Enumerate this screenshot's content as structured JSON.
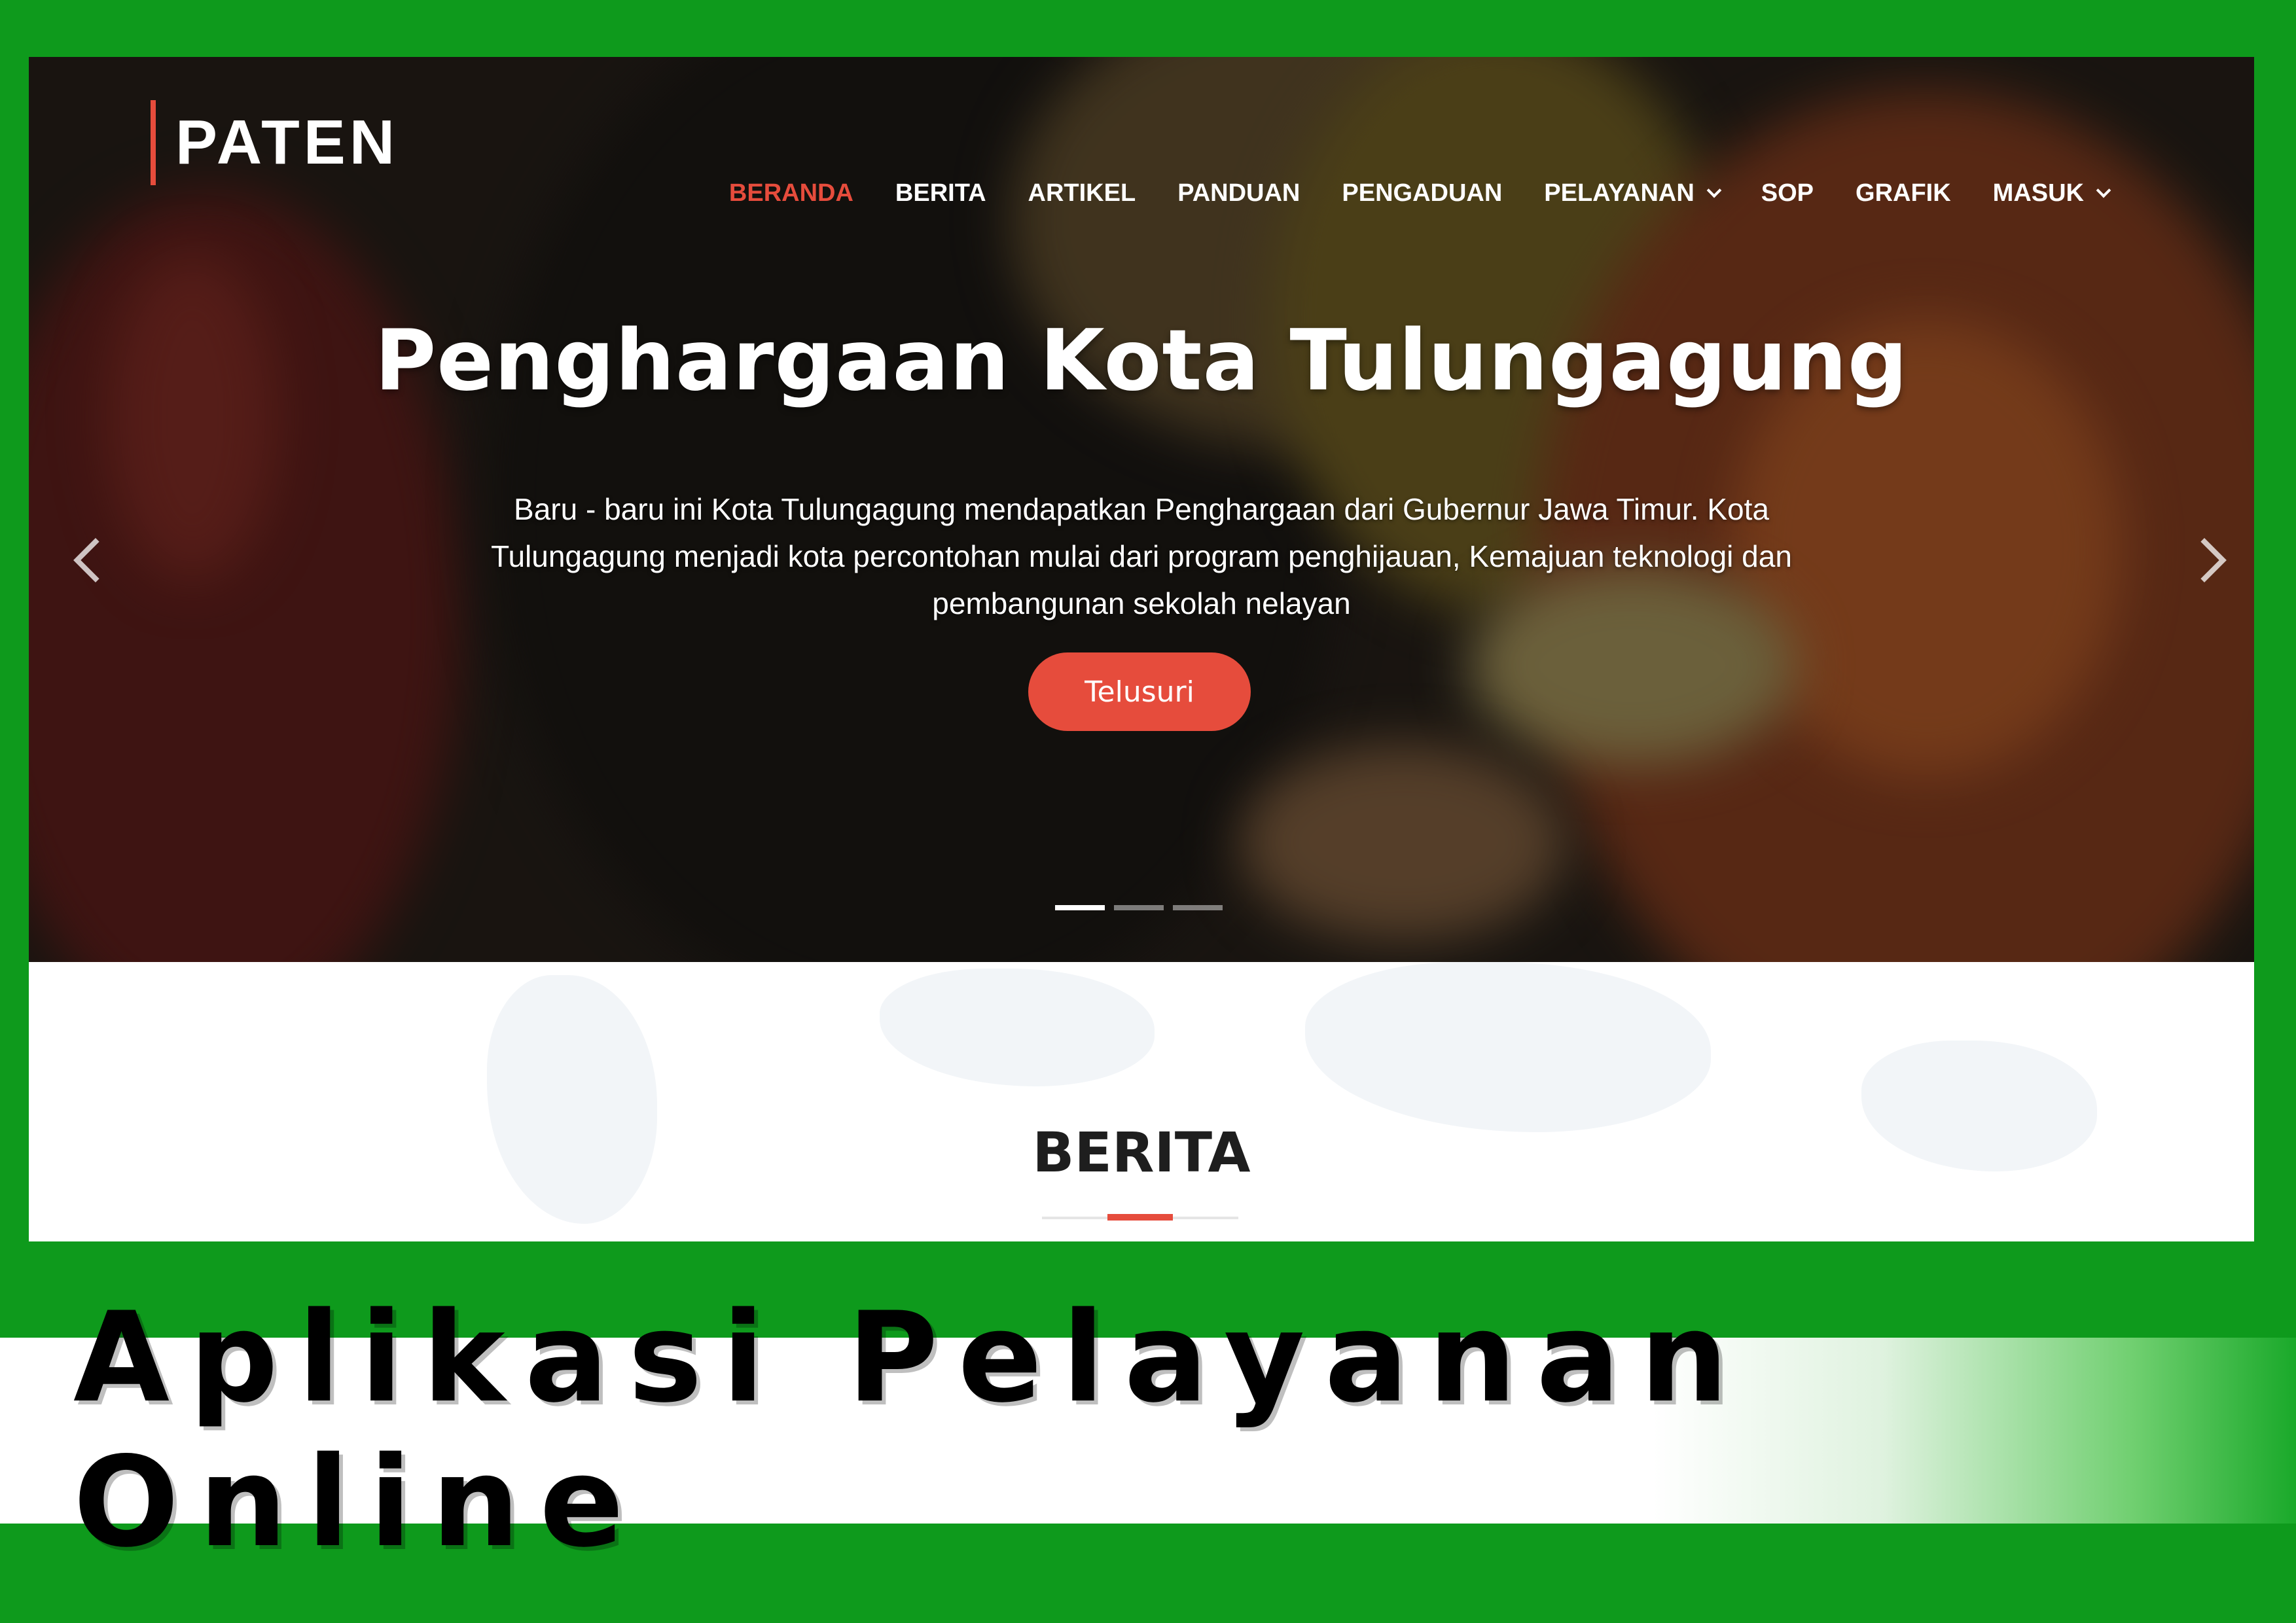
{
  "brand": {
    "name": "PATEN"
  },
  "nav": {
    "items": [
      {
        "label": "BERANDA",
        "active": true,
        "dropdown": false
      },
      {
        "label": "BERITA",
        "active": false,
        "dropdown": false
      },
      {
        "label": "ARTIKEL",
        "active": false,
        "dropdown": false
      },
      {
        "label": "PANDUAN",
        "active": false,
        "dropdown": false
      },
      {
        "label": "PENGADUAN",
        "active": false,
        "dropdown": false
      },
      {
        "label": "PELAYANAN",
        "active": false,
        "dropdown": true
      },
      {
        "label": "SOP",
        "active": false,
        "dropdown": false
      },
      {
        "label": "GRAFIK",
        "active": false,
        "dropdown": false
      },
      {
        "label": "MASUK",
        "active": false,
        "dropdown": true
      }
    ]
  },
  "hero": {
    "title": "Penghargaan Kota Tulungagung",
    "description": "Baru - baru ini Kota Tulungagung mendapatkan Penghargaan dari Gubernur Jawa Timur. Kota Tulungagung menjadi kota percontohan mulai dari program penghijauan, Kemajuan teknologi dan pembangunan sekolah nelayan",
    "button_label": "Telusuri",
    "slides_total": 3,
    "active_slide": 1
  },
  "section": {
    "title": "BERITA"
  },
  "caption": {
    "text": "Aplikasi Pelayanan Online"
  },
  "colors": {
    "accent": "#e64c3c",
    "frame_green": "#0e9a1c",
    "white": "#ffffff"
  },
  "icons": {
    "prev": "chevron-left-icon",
    "next": "chevron-right-icon",
    "dropdown": "chevron-down-icon"
  }
}
